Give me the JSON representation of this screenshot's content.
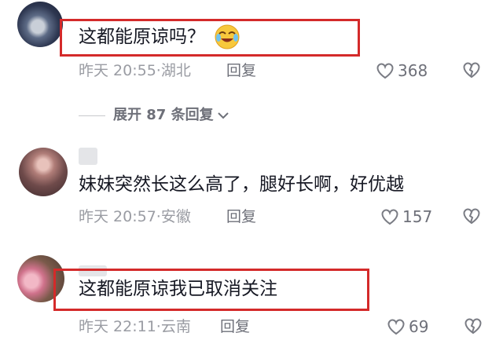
{
  "comments": [
    {
      "text": "这都能原谅吗？",
      "time": "昨天 20:55",
      "location": "湖北",
      "reply_label": "回复",
      "likes": "368",
      "emoji": "crying-laughing-emoji",
      "highlighted": true
    },
    {
      "text": "妹妹突然长这么高了，腿好长啊，好优越",
      "time": "昨天 20:57",
      "location": "安徽",
      "reply_label": "回复",
      "likes": "157",
      "highlighted": false
    },
    {
      "text": "这都能原谅我已取消关注",
      "time": "昨天 22:11",
      "location": "云南",
      "reply_label": "回复",
      "likes": "69",
      "highlighted": true
    }
  ],
  "expand": {
    "label": "展开 87 条回复"
  },
  "sep": "·",
  "icons": {
    "like": "heart-outline-icon",
    "dislike": "broken-heart-icon",
    "expand": "chevron-down-icon"
  },
  "colors": {
    "highlight_border": "#d42a2a",
    "meta_text": "#9a9ca3",
    "body_text": "#161823"
  }
}
